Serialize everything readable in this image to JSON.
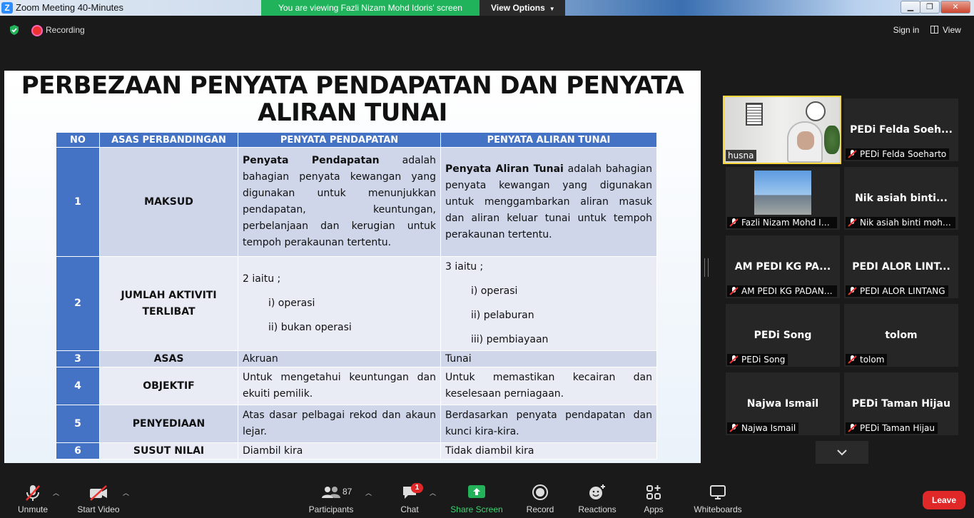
{
  "window": {
    "title": "Zoom Meeting 40-Minutes",
    "app_icon": "Z",
    "share_banner": "You are viewing Fazli Nizam Mohd Idoris' screen",
    "view_options": "View Options",
    "controls": [
      "minimize-icon",
      "maximize-icon",
      "close-icon"
    ]
  },
  "topbar": {
    "recording": "Recording",
    "sign_in": "Sign in",
    "view": "View"
  },
  "slide": {
    "title": "PERBEZAAN PENYATA PENDAPATAN DAN PENYATA ALIRAN TUNAI",
    "headers": [
      "NO",
      "ASAS PERBANDINGAN",
      "PENYATA PENDAPATAN",
      "PENYATA ALIRAN TUNAI"
    ],
    "rows": [
      {
        "no": "1",
        "basis": "MAKSUD",
        "income_bold": "Penyata Pendapatan",
        "income_rest": " adalah bahagian penyata kewangan yang digunakan untuk menunjukkan pendapatan, keuntungan, perbelanjaan dan kerugian untuk tempoh perakaunan tertentu.",
        "cash_bold": "Penyata Aliran Tunai",
        "cash_rest": " adalah bahagian penyata kewangan yang digunakan untuk menggambarkan aliran masuk dan aliran keluar tunai untuk tempoh perakaunan tertentu."
      },
      {
        "no": "2",
        "basis": "JUMLAH AKTIVITI TERLIBAT",
        "income_intro": "2 iaitu ;",
        "income_items": [
          "i) operasi",
          "ii) bukan operasi"
        ],
        "cash_intro": "3 iaitu ;",
        "cash_items": [
          "i) operasi",
          "ii) pelaburan",
          "iii) pembiayaan"
        ]
      },
      {
        "no": "3",
        "basis": "ASAS",
        "income": "Akruan",
        "cash": "Tunai"
      },
      {
        "no": "4",
        "basis": "OBJEKTIF",
        "income": "Untuk mengetahui keuntungan dan ekuiti pemilik.",
        "cash": "Untuk memastikan kecairan dan keselesaan perniagaan."
      },
      {
        "no": "5",
        "basis": "PENYEDIAAN",
        "income": "Atas dasar pelbagai rekod dan akaun lejar.",
        "cash": "Berdasarkan penyata pendapatan dan kunci kira-kira."
      },
      {
        "no": "6",
        "basis": "SUSUT NILAI",
        "income": "Diambil kira",
        "cash": "Tidak diambil kira"
      }
    ]
  },
  "participants_grid": [
    {
      "tile_name": "",
      "label": "husna",
      "muted": false,
      "active_speaker": true
    },
    {
      "tile_name": "PEDi  Felda  Soeh...",
      "label": "PEDi Felda Soeharto",
      "muted": true
    },
    {
      "tile_name": "",
      "label": "Fazli Nizam Mohd Id...",
      "muted": true,
      "thumbnail": true
    },
    {
      "tile_name": "Nik asiah binti...",
      "label": "Nik asiah binti moha...",
      "muted": true
    },
    {
      "tile_name": "AM PEDI KG PA...",
      "label": "AM PEDI KG PADANG...",
      "muted": true
    },
    {
      "tile_name": "PEDI ALOR LINT...",
      "label": "PEDI ALOR LINTANG",
      "muted": true
    },
    {
      "tile_name": "PEDi Song",
      "label": "PEDi Song",
      "muted": true
    },
    {
      "tile_name": "tolom",
      "label": "tolom",
      "muted": true
    },
    {
      "tile_name": "Najwa Ismail",
      "label": "Najwa Ismail",
      "muted": true
    },
    {
      "tile_name": "PEDi Taman Hijau",
      "label": "PEDi Taman Hijau",
      "muted": true
    }
  ],
  "toolbar": {
    "unmute": "Unmute",
    "start_video": "Start Video",
    "participants": "Participants",
    "participants_count": "87",
    "chat": "Chat",
    "chat_badge": "1",
    "share_screen": "Share Screen",
    "record": "Record",
    "reactions": "Reactions",
    "apps": "Apps",
    "whiteboards": "Whiteboards",
    "leave": "Leave"
  },
  "colors": {
    "accent_green": "#21b35c",
    "table_header": "#4472c4",
    "leave_red": "#e02828",
    "active_speaker": "#f7d63b"
  }
}
